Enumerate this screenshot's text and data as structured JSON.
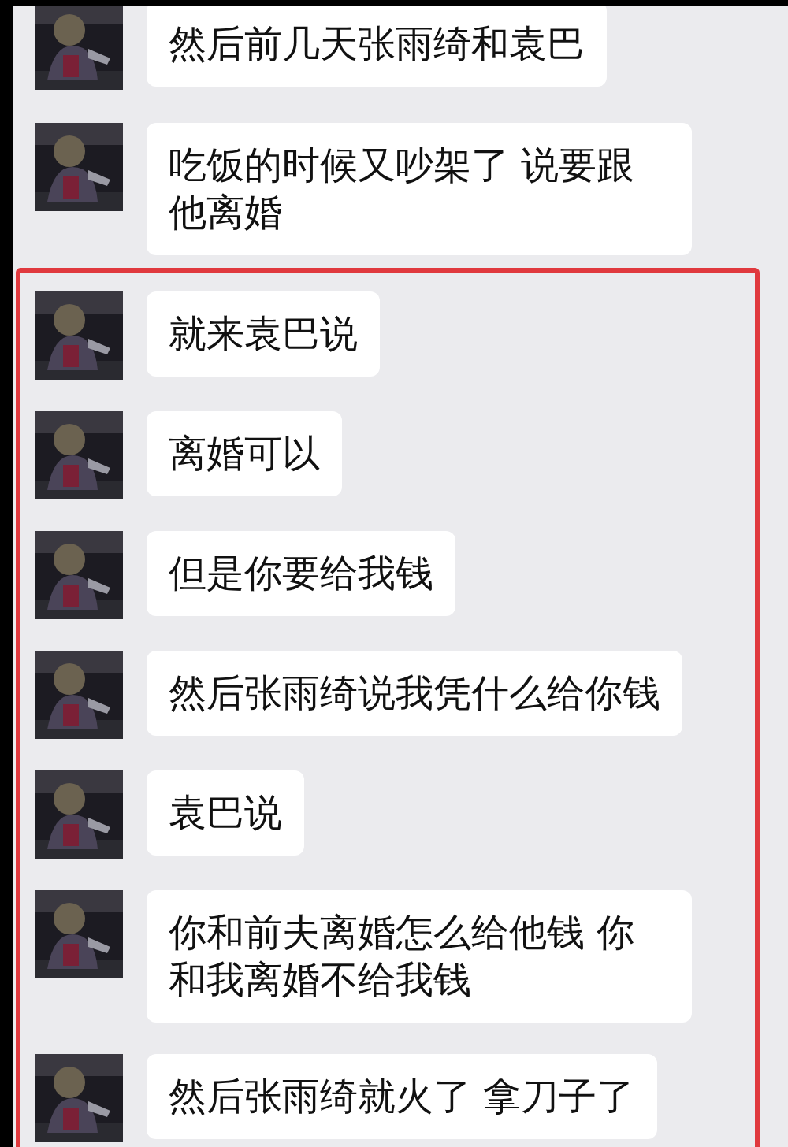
{
  "messages": [
    {
      "text": "然后前几天张雨绮和袁巴"
    },
    {
      "text": "吃饭的时候又吵架了 说要跟他离婚"
    }
  ],
  "highlight_box": {
    "messages": [
      {
        "text": "就来袁巴说"
      },
      {
        "text": "离婚可以"
      },
      {
        "text": "但是你要给我钱"
      },
      {
        "text": "然后张雨绮说我凭什么给你钱"
      },
      {
        "text": "袁巴说"
      },
      {
        "text": "你和前夫离婚怎么给他钱 你和我离婚不给我钱"
      },
      {
        "text": "然后张雨绮就火了 拿刀子了"
      }
    ]
  }
}
